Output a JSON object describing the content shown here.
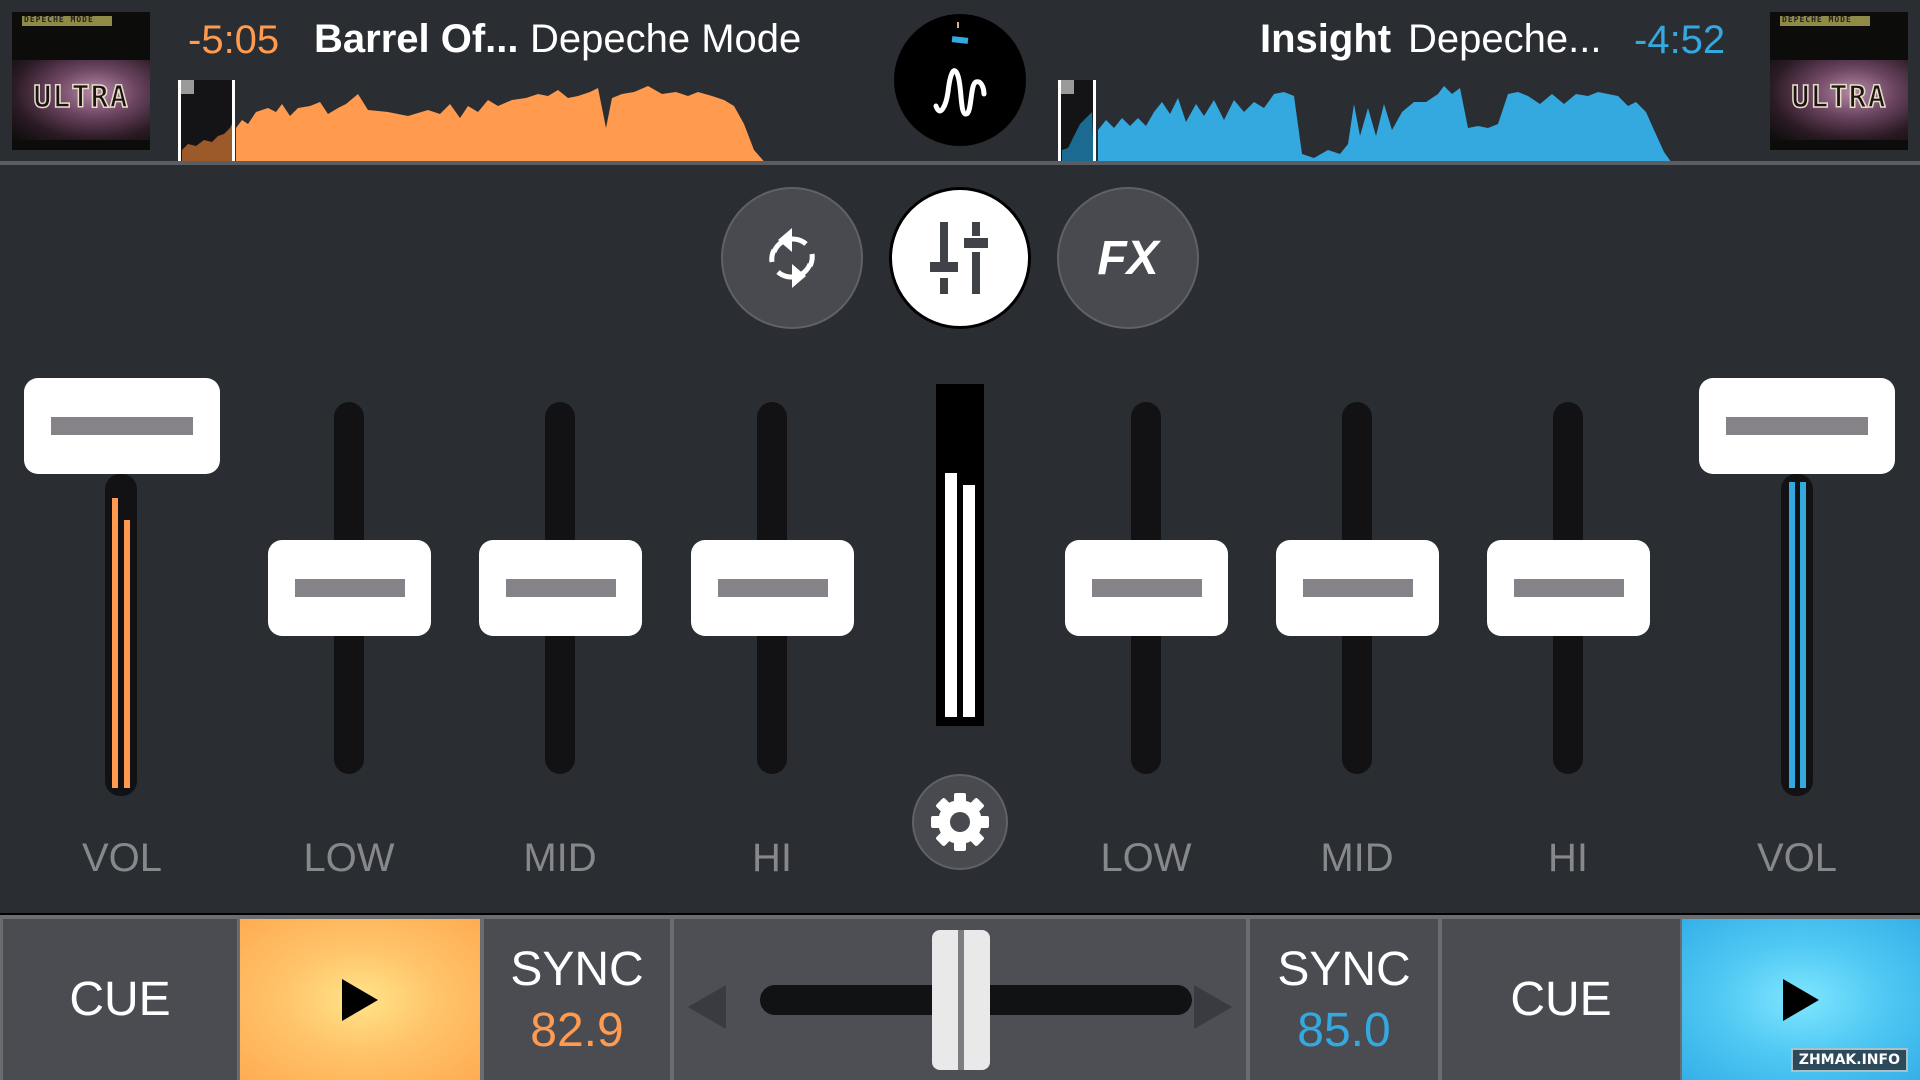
{
  "app": {
    "accent_left": "#ff9a4f",
    "accent_right": "#34a9e0"
  },
  "deck_a": {
    "time_remaining": "-5:05",
    "title": "Barrel Of...",
    "artist": "Depeche Mode",
    "album_art": {
      "band_text": "DEPECHE MODE",
      "album_text": "ULTRA"
    },
    "position_fraction": 0.06,
    "volume_fraction": 1.0,
    "level_meters": [
      0.78,
      0.7
    ],
    "eq": {
      "low": 0.5,
      "mid": 0.5,
      "hi": 0.5
    },
    "bpm": "82.9",
    "cue_label": "CUE",
    "sync_label": "SYNC",
    "play_icon": "play-icon"
  },
  "deck_b": {
    "time_remaining": "-4:52",
    "title": "Insight",
    "artist": "Depeche...",
    "album_art": {
      "band_text": "DEPECHE MODE",
      "album_text": "ULTRA"
    },
    "position_fraction": 0.05,
    "volume_fraction": 1.0,
    "level_meters": [
      1.0,
      1.0
    ],
    "eq": {
      "low": 0.5,
      "mid": 0.5,
      "hi": 0.5
    },
    "bpm": "85.0",
    "cue_label": "CUE",
    "sync_label": "SYNC",
    "play_icon": "play-icon"
  },
  "center": {
    "logo_icon": "waveform-logo-icon",
    "modes": [
      {
        "name": "loop-sync",
        "icon": "refresh-icon",
        "active": false
      },
      {
        "name": "mixer",
        "icon": "mixer-sliders-icon",
        "active": true
      },
      {
        "name": "fx",
        "label": "FX",
        "active": false
      }
    ],
    "master_meter": [
      0.72,
      0.68
    ],
    "settings_icon": "gear-icon"
  },
  "labels": {
    "vol": "VOL",
    "low": "LOW",
    "mid": "MID",
    "hi": "HI"
  },
  "crossfader": {
    "position_fraction": 0.5
  },
  "watermark": "ZHMAK.INFO"
}
